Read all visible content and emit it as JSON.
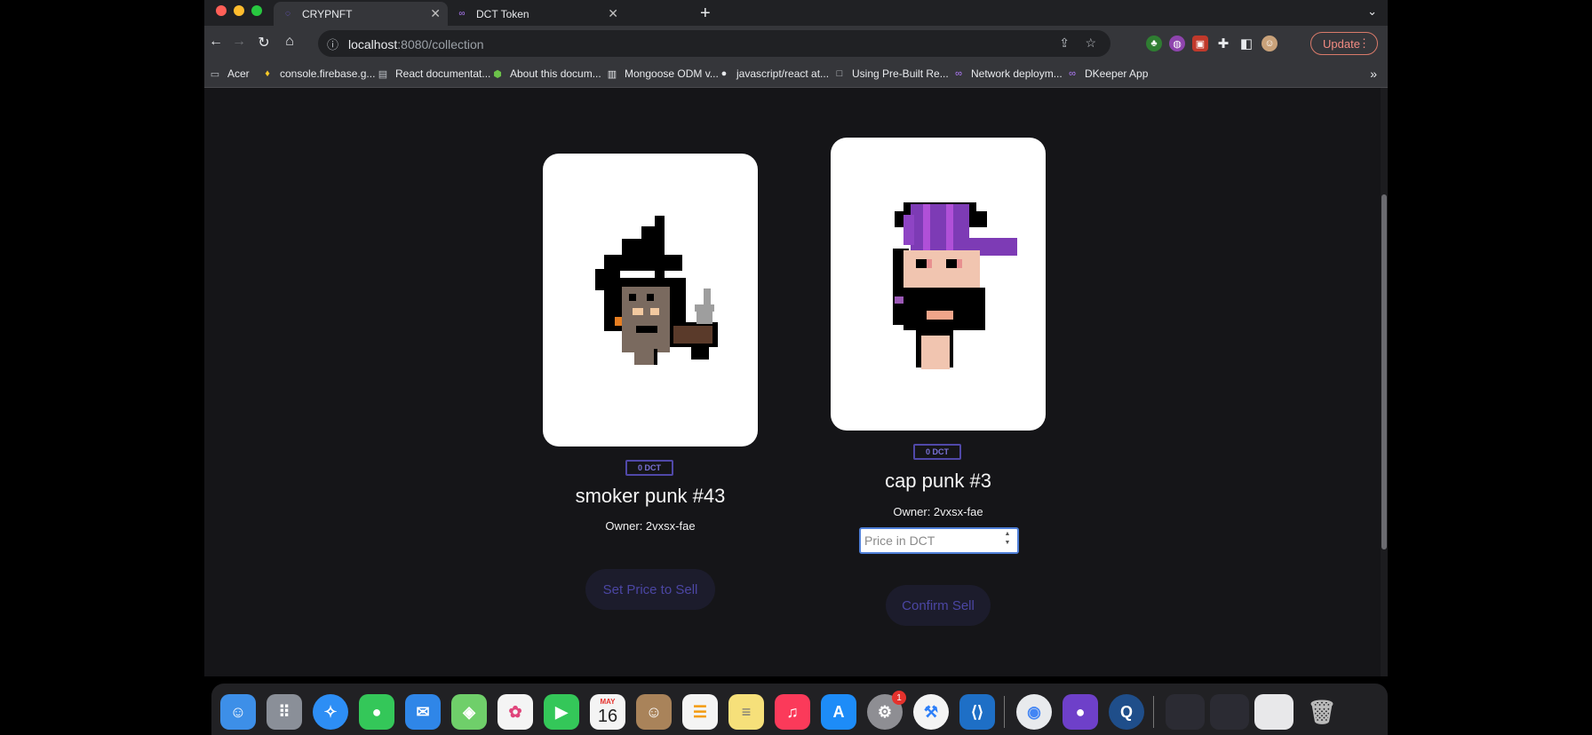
{
  "browser": {
    "tabs": [
      {
        "title": "CRYPNFT",
        "active": true
      },
      {
        "title": "DCT Token",
        "active": false
      }
    ],
    "url_host": "localhost",
    "url_path": ":8080/collection",
    "update_label": "Update",
    "bookmarks": [
      {
        "label": "Acer",
        "icon": "folder-icon"
      },
      {
        "label": "console.firebase.g...",
        "icon": "firebase-icon"
      },
      {
        "label": "React documentat...",
        "icon": "react-doc-icon"
      },
      {
        "label": "About this docum...",
        "icon": "node-icon"
      },
      {
        "label": "Mongoose ODM v...",
        "icon": "mongoose-icon"
      },
      {
        "label": "javascript/react at...",
        "icon": "github-icon"
      },
      {
        "label": "Using Pre-Built Re...",
        "icon": "page-icon"
      },
      {
        "label": "Network deploym...",
        "icon": "dfinity-icon"
      },
      {
        "label": "DKeeper App",
        "icon": "dfinity-icon"
      }
    ]
  },
  "nfts": [
    {
      "price": "0 DCT",
      "name": "smoker punk #43",
      "owner": "Owner: 2vxsx-fae",
      "button": "Set Price to Sell"
    },
    {
      "price": "0 DCT",
      "name": "cap punk #3",
      "owner": "Owner: 2vxsx-fae",
      "input_placeholder": "Price in DCT",
      "button": "Confirm Sell"
    }
  ],
  "dock": {
    "calendar_month": "MAY",
    "calendar_day": "16",
    "settings_badge": "1"
  },
  "colors": {
    "page_bg": "#151518",
    "button_text": "#4b46a3",
    "badge_border": "#5048a8",
    "update": "#f28b82"
  }
}
